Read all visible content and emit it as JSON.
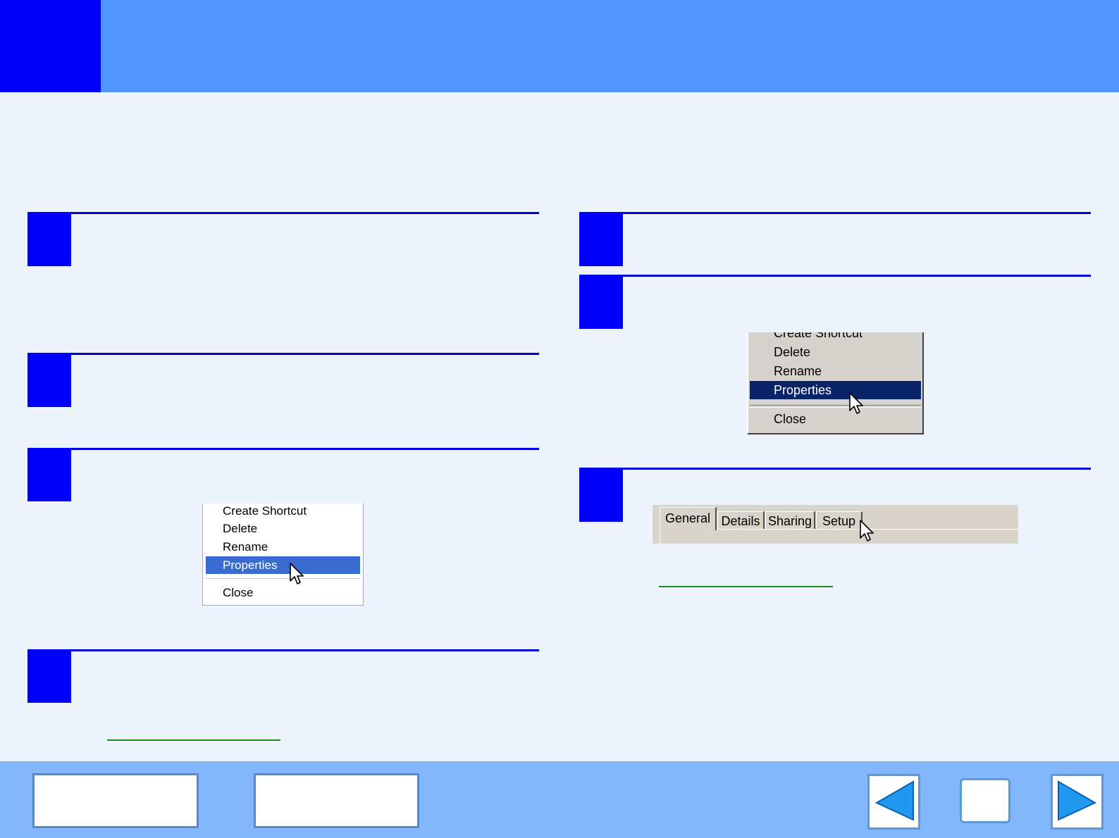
{
  "menu_xp": {
    "items": [
      "Create Shortcut",
      "Delete",
      "Rename",
      "Properties",
      "Close"
    ],
    "selected": "Properties"
  },
  "menu_classic": {
    "items": [
      "Create Shortcut",
      "Delete",
      "Rename",
      "Properties",
      "Close"
    ],
    "selected": "Properties"
  },
  "tabs": [
    "General",
    "Details",
    "Sharing",
    "Setup"
  ],
  "active_tab": "General",
  "colors": {
    "header": "#5297fd",
    "header_block": "#0000fc",
    "step_marker": "#0000fc",
    "page_background": "#edf3fd",
    "footer": "#83b6fc",
    "xp_selection": "#3a6bd0",
    "classic_selection": "#0a246a",
    "link_underline": "#1a8a1a"
  },
  "icons": {
    "cursor": "mouse-pointer-icon",
    "prev": "triangle-left-icon",
    "next": "triangle-right-icon"
  }
}
